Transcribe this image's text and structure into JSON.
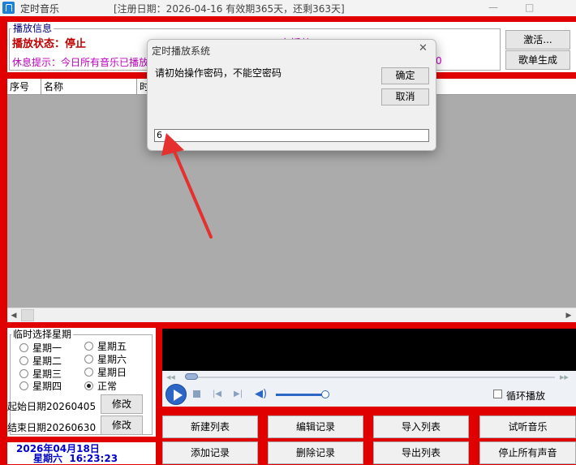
{
  "window": {
    "title": "定时音乐",
    "info": "[注册日期：2026-04-16   有效期365天，还剩363天]",
    "min": "—",
    "max": "□"
  },
  "playback": {
    "group_label": "播放信息",
    "status_label": "播放状态：停止",
    "hint": "休息提示：今日所有音乐已播放",
    "hidden_red": "下一次播放：下",
    "hidden_right": "0"
  },
  "side_buttons": {
    "activate": "激活...",
    "playlist_gen": "歌单生成"
  },
  "list": {
    "columns": [
      "序号",
      "名称",
      "时"
    ]
  },
  "weekday": {
    "group_label": "临时选择星期",
    "options": [
      {
        "label": "星期一",
        "checked": false
      },
      {
        "label": "星期五",
        "checked": false
      },
      {
        "label": "星期二",
        "checked": false
      },
      {
        "label": "星期六",
        "checked": false
      },
      {
        "label": "星期三",
        "checked": false
      },
      {
        "label": "星期日",
        "checked": false
      },
      {
        "label": "星期四",
        "checked": false
      },
      {
        "label": "正常",
        "checked": true
      }
    ],
    "start_date": "起始日期20260405",
    "end_date": "结束日期20260630",
    "modify": "修改"
  },
  "clock": {
    "date": "2026年04月18日",
    "time": "星期六  16:23:23"
  },
  "player": {
    "loop_label": "循环播放",
    "loop_checked": false,
    "progress": 0.0,
    "volume": 0.8
  },
  "buttons": {
    "new_list": "新建列表",
    "edit_record": "编辑记录",
    "import_list": "导入列表",
    "try_music": "试听音乐",
    "add_record": "添加记录",
    "delete_record": "删除记录",
    "export_list": "导出列表",
    "stop_all": "停止所有声音"
  },
  "dialog": {
    "title": "定时播放系统",
    "message": "请初始操作密码，不能空密码",
    "ok": "确定",
    "cancel": "取消",
    "close": "✕",
    "input_value": "6"
  },
  "colors": {
    "frame_red": "#e00000",
    "status_red": "#c00000",
    "hint_magenta": "#c000c0",
    "clock_blue": "#0000cc",
    "arrow_red": "#e53030"
  }
}
